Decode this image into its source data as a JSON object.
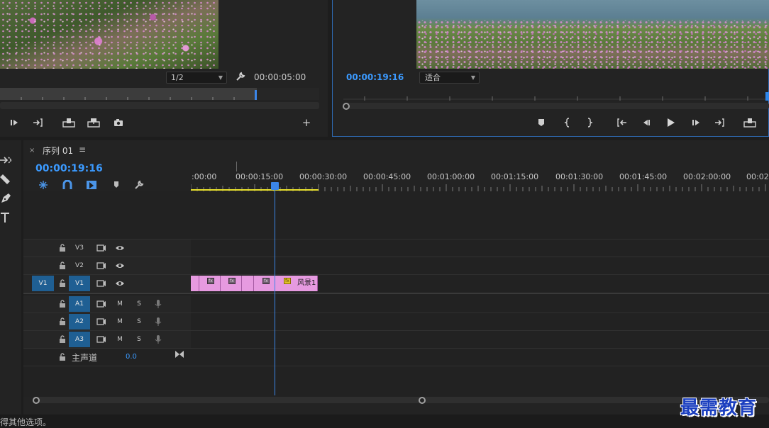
{
  "source_monitor": {
    "resolution_value": "1/2",
    "timecode": "00:00:05:00",
    "add_button": "+"
  },
  "program_monitor": {
    "timecode": "00:00:19:16",
    "fit_value": "适合"
  },
  "timeline": {
    "tab_label": "序列 01",
    "tab_close": "×",
    "tab_menu": "≡",
    "timecode": "00:00:19:16",
    "ruler_labels": [
      ":00:00",
      "00:00:15:00",
      "00:00:30:00",
      "00:00:45:00",
      "00:01:00:00",
      "00:01:15:00",
      "00:01:30:00",
      "00:01:45:00",
      "00:02:00:00",
      "00:02:"
    ],
    "tracks": {
      "video": [
        {
          "name": "V3"
        },
        {
          "name": "V2"
        },
        {
          "name": "V1",
          "source": "V1"
        }
      ],
      "audio": [
        {
          "name": "A1",
          "mute": "M",
          "solo": "S"
        },
        {
          "name": "A2",
          "mute": "M",
          "solo": "S"
        },
        {
          "name": "A3",
          "mute": "M",
          "solo": "S"
        }
      ]
    },
    "clip": {
      "fx_label": "fx",
      "label": "风景1",
      "color": "#e69ae0"
    },
    "master": {
      "label": "主声道",
      "value": "0.0"
    }
  },
  "status_bar": {
    "text": "得其他选项。"
  },
  "watermark": {
    "text": "最需教育"
  },
  "colors": {
    "accent_blue": "#3b9aff",
    "work_area_yellow": "#e8e02c",
    "playhead": "#3b86e8",
    "track_target": "#1f5f93"
  }
}
